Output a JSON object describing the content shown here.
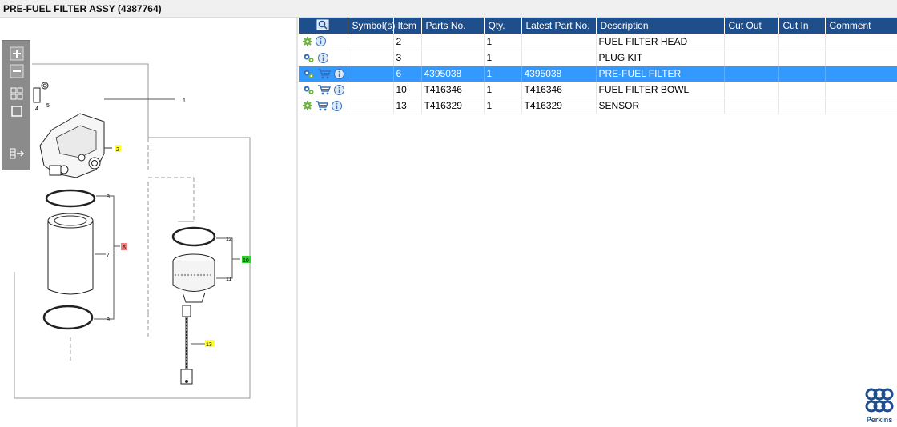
{
  "title": "PRE-FUEL FILTER ASSY (4387764)",
  "toolbox": {
    "items": [
      {
        "name": "zoom-in-icon"
      },
      {
        "name": "zoom-out-icon"
      },
      {
        "name": "fit-all-icon"
      },
      {
        "name": "fit-window-icon"
      },
      {
        "name": "toggle-panel-icon"
      }
    ]
  },
  "diagram": {
    "callouts": [
      {
        "label": "1"
      },
      {
        "label": "2"
      },
      {
        "label": "4"
      },
      {
        "label": "5"
      },
      {
        "label": "6"
      },
      {
        "label": "7"
      },
      {
        "label": "8"
      },
      {
        "label": "9"
      },
      {
        "label": "10"
      },
      {
        "label": "11"
      },
      {
        "label": "12"
      },
      {
        "label": "13"
      }
    ],
    "highlight_colors": {
      "yellow": "#ffff33",
      "red": "#f08080",
      "green": "#33cc33"
    }
  },
  "table": {
    "columns": [
      "",
      "Symbol(s)",
      "Item",
      "Parts No.",
      "Qty.",
      "Latest Part No.",
      "Description",
      "Cut Out",
      "Cut In",
      "Comment"
    ],
    "rows": [
      {
        "icons": [
          "gear-green-icon",
          "info-icon"
        ],
        "item": "2",
        "part_no": "",
        "qty": "1",
        "latest": "",
        "desc": "FUEL FILTER HEAD",
        "cut_out": "",
        "cut_in": "",
        "comment": "",
        "selected": false
      },
      {
        "icons": [
          "gears-icon",
          "info-icon"
        ],
        "item": "3",
        "part_no": "",
        "qty": "1",
        "latest": "",
        "desc": "PLUG KIT",
        "cut_out": "",
        "cut_in": "",
        "comment": "",
        "selected": false
      },
      {
        "icons": [
          "gears-icon",
          "cart-icon",
          "info-icon"
        ],
        "item": "6",
        "part_no": "4395038",
        "qty": "1",
        "latest": "4395038",
        "desc": "PRE-FUEL FILTER",
        "cut_out": "",
        "cut_in": "",
        "comment": "",
        "selected": true
      },
      {
        "icons": [
          "gears-icon",
          "cart-icon",
          "info-icon"
        ],
        "item": "10",
        "part_no": "T416346",
        "qty": "1",
        "latest": "T416346",
        "desc": "FUEL FILTER BOWL",
        "cut_out": "",
        "cut_in": "",
        "comment": "",
        "selected": false
      },
      {
        "icons": [
          "gear-green-icon",
          "cart-icon",
          "info-icon"
        ],
        "item": "13",
        "part_no": "T416329",
        "qty": "1",
        "latest": "T416329",
        "desc": "SENSOR",
        "cut_out": "",
        "cut_in": "",
        "comment": "",
        "selected": false
      }
    ]
  },
  "colors": {
    "header_bg": "#1f4e8c",
    "selected_row": "#3399ff",
    "brand": "#1f4e8c"
  },
  "brand": {
    "logo_text": "Perkins"
  }
}
